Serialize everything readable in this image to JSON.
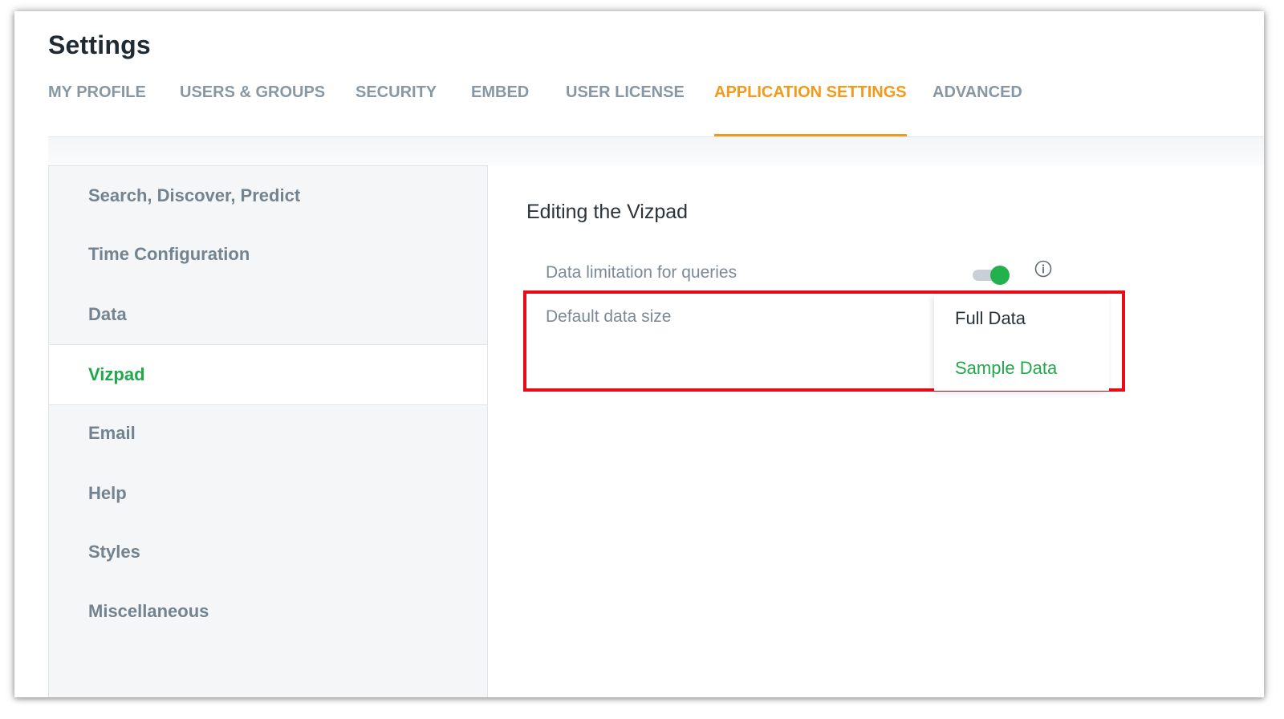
{
  "header": {
    "title": "Settings"
  },
  "tabs": [
    {
      "label": "MY PROFILE"
    },
    {
      "label": "USERS & GROUPS"
    },
    {
      "label": "SECURITY"
    },
    {
      "label": "EMBED"
    },
    {
      "label": "USER LICENSE"
    },
    {
      "label": "APPLICATION SETTINGS",
      "active": true
    },
    {
      "label": "ADVANCED"
    }
  ],
  "sidebar": {
    "items": [
      {
        "label": "Search, Discover, Predict"
      },
      {
        "label": "Time Configuration"
      },
      {
        "label": "Data"
      },
      {
        "label": "Vizpad",
        "active": true
      },
      {
        "label": "Email"
      },
      {
        "label": "Help"
      },
      {
        "label": "Styles"
      },
      {
        "label": "Miscellaneous"
      }
    ]
  },
  "main": {
    "section_title": "Editing the Vizpad",
    "data_limitation": {
      "label": "Data limitation for queries",
      "enabled": true,
      "icon": "info-icon"
    },
    "default_data_size": {
      "label": "Default data size",
      "options": [
        "Full Data",
        "Sample Data"
      ],
      "selected": "Sample Data"
    }
  },
  "colors": {
    "accent_tab": "#f49a1a",
    "active_green": "#21a84a",
    "highlight_red": "#ea0a17"
  }
}
